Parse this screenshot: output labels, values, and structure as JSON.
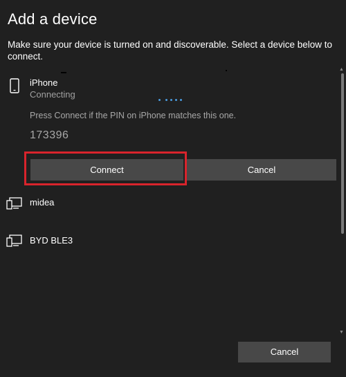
{
  "dialog": {
    "title": "Add a device",
    "subtitle": "Make sure your device is turned on and discoverable. Select a device below to connect."
  },
  "devices": [
    {
      "name": "iPhone",
      "icon": "phone-icon",
      "status": "Connecting",
      "pin_prompt": "Press Connect if the PIN on iPhone matches this one.",
      "pin": "173396",
      "connect_label": "Connect",
      "cancel_label": "Cancel"
    },
    {
      "name": "midea",
      "icon": "display-device-icon"
    },
    {
      "name": "BYD BLE3",
      "icon": "display-device-icon"
    }
  ],
  "footer": {
    "cancel_label": "Cancel"
  },
  "colors": {
    "background": "#202020",
    "button": "#484848",
    "highlight": "#d9242c",
    "progress": "#4a9bde",
    "secondary_text": "#a0a0a0"
  }
}
